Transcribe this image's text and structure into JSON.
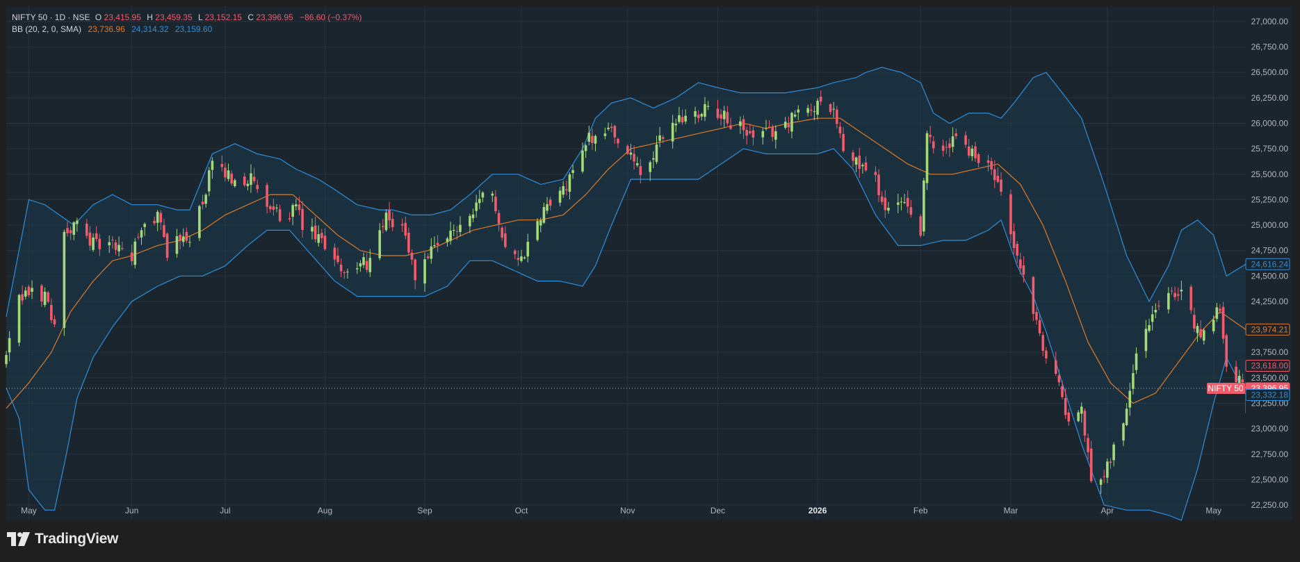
{
  "header": {
    "symbol": "NIFTY 50 · 1D · NSE",
    "o_label": "O",
    "o_value": "23,415.95",
    "h_label": "H",
    "h_value": "23,459.35",
    "l_label": "L",
    "l_value": "23,152.15",
    "c_label": "C",
    "c_value": "23,396.95",
    "change": "−86.60 (−0.37%)",
    "bb_label": "BB (20, 2, 0, SMA)",
    "bb_basis": "23,736.96",
    "bb_upper": "24,314.32",
    "bb_lower": "23,159.60"
  },
  "branding": {
    "name": "TradingView"
  },
  "colors": {
    "up": "#a3d977",
    "down": "#f15b6c",
    "upper_band": "#2f8fdc",
    "lower_band": "#2f8fdc",
    "basis": "#e07a26",
    "band_fill": "#1c3a4c",
    "background": "#1a252e",
    "grid": "#263540",
    "text": "#b2b5be"
  },
  "chart_data": {
    "type": "candlestick",
    "symbol": "NIFTY 50",
    "interval": "1D",
    "exchange": "NSE",
    "indicator": "Bollinger Bands (20, 2, 0, SMA)",
    "y_range": [
      22100,
      27150
    ],
    "y_ticks": [
      "27,000.00",
      "26,750.00",
      "26,500.00",
      "26,250.00",
      "26,000.00",
      "25,750.00",
      "25,500.00",
      "25,250.00",
      "25,000.00",
      "24,750.00",
      "24,500.00",
      "24,250.00",
      "24,000.00",
      "23,750.00",
      "23,500.00",
      "23,250.00",
      "23,000.00",
      "22,750.00",
      "22,500.00",
      "22,250.00"
    ],
    "x_range": [
      "2025-04-24",
      "2026-05-14"
    ],
    "x_ticks": [
      {
        "label": "May",
        "date": "2025-05-01"
      },
      {
        "label": "Jun",
        "date": "2025-06-02"
      },
      {
        "label": "Jul",
        "date": "2025-07-01"
      },
      {
        "label": "Aug",
        "date": "2025-08-01"
      },
      {
        "label": "Sep",
        "date": "2025-09-01"
      },
      {
        "label": "Oct",
        "date": "2025-10-01"
      },
      {
        "label": "Nov",
        "date": "2025-11-03"
      },
      {
        "label": "Dec",
        "date": "2025-12-01"
      },
      {
        "label": "2026",
        "date": "2026-01-01"
      },
      {
        "label": "Feb",
        "date": "2026-02-02"
      },
      {
        "label": "Mar",
        "date": "2026-03-02"
      },
      {
        "label": "Apr",
        "date": "2026-04-01"
      },
      {
        "label": "May",
        "date": "2026-05-04"
      }
    ],
    "close_points": [
      [
        "2025-04-24",
        23700
      ],
      [
        "2025-04-28",
        24250
      ],
      [
        "2025-05-02",
        24350
      ],
      [
        "2025-05-06",
        24300
      ],
      [
        "2025-05-09",
        24050
      ],
      [
        "2025-05-12",
        24900
      ],
      [
        "2025-05-16",
        25000
      ],
      [
        "2025-05-22",
        24800
      ],
      [
        "2025-05-27",
        24800
      ],
      [
        "2025-06-02",
        24700
      ],
      [
        "2025-06-06",
        25000
      ],
      [
        "2025-06-10",
        25100
      ],
      [
        "2025-06-13",
        24750
      ],
      [
        "2025-06-17",
        24850
      ],
      [
        "2025-06-20",
        24900
      ],
      [
        "2025-06-24",
        25200
      ],
      [
        "2025-06-27",
        25600
      ],
      [
        "2025-07-01",
        25500
      ],
      [
        "2025-07-04",
        25450
      ],
      [
        "2025-07-09",
        25450
      ],
      [
        "2025-07-14",
        25150
      ],
      [
        "2025-07-18",
        25100
      ],
      [
        "2025-07-23",
        25150
      ],
      [
        "2025-07-25",
        25000
      ],
      [
        "2025-07-30",
        24850
      ],
      [
        "2025-08-04",
        24700
      ],
      [
        "2025-08-08",
        24500
      ],
      [
        "2025-08-12",
        24600
      ],
      [
        "2025-08-15",
        24650
      ],
      [
        "2025-08-20",
        25050
      ],
      [
        "2025-08-25",
        25000
      ],
      [
        "2025-08-29",
        24500
      ],
      [
        "2025-09-02",
        24700
      ],
      [
        "2025-09-05",
        24750
      ],
      [
        "2025-09-10",
        24950
      ],
      [
        "2025-09-15",
        25100
      ],
      [
        "2025-09-19",
        25350
      ],
      [
        "2025-09-23",
        25200
      ],
      [
        "2025-09-26",
        24800
      ],
      [
        "2025-10-01",
        24650
      ],
      [
        "2025-10-06",
        25000
      ],
      [
        "2025-10-10",
        25250
      ],
      [
        "2025-10-15",
        25350
      ],
      [
        "2025-10-20",
        25800
      ],
      [
        "2025-10-24",
        25900
      ],
      [
        "2025-10-29",
        25950
      ],
      [
        "2025-11-03",
        25700
      ],
      [
        "2025-11-07",
        25500
      ],
      [
        "2025-11-11",
        25650
      ],
      [
        "2025-11-14",
        25900
      ],
      [
        "2025-11-19",
        26050
      ],
      [
        "2025-11-24",
        26100
      ],
      [
        "2025-11-28",
        26200
      ],
      [
        "2025-12-03",
        26050
      ],
      [
        "2025-12-08",
        25950
      ],
      [
        "2025-12-12",
        25850
      ],
      [
        "2025-12-17",
        25900
      ],
      [
        "2025-12-22",
        26000
      ],
      [
        "2025-12-26",
        26100
      ],
      [
        "2025-12-31",
        26150
      ],
      [
        "2026-01-02",
        26250
      ],
      [
        "2026-01-06",
        26150
      ],
      [
        "2026-01-09",
        25700
      ],
      [
        "2026-01-14",
        25600
      ],
      [
        "2026-01-19",
        25450
      ],
      [
        "2026-01-22",
        25150
      ],
      [
        "2026-01-27",
        25200
      ],
      [
        "2026-02-02",
        24950
      ],
      [
        "2026-02-04",
        25850
      ],
      [
        "2026-02-09",
        25700
      ],
      [
        "2026-02-13",
        25900
      ],
      [
        "2026-02-18",
        25700
      ],
      [
        "2026-02-23",
        25600
      ],
      [
        "2026-02-27",
        25300
      ],
      [
        "2026-03-02",
        24850
      ],
      [
        "2026-03-06",
        24500
      ],
      [
        "2026-03-10",
        24000
      ],
      [
        "2026-03-13",
        23700
      ],
      [
        "2026-03-17",
        23500
      ],
      [
        "2026-03-20",
        23000
      ],
      [
        "2026-03-24",
        23200
      ],
      [
        "2026-03-27",
        22500
      ],
      [
        "2026-03-31",
        22600
      ],
      [
        "2026-04-03",
        22800
      ],
      [
        "2026-04-07",
        23200
      ],
      [
        "2026-04-10",
        23800
      ],
      [
        "2026-04-15",
        24100
      ],
      [
        "2026-04-20",
        24400
      ],
      [
        "2026-04-24",
        24300
      ],
      [
        "2026-04-29",
        23950
      ],
      [
        "2026-05-04",
        24050
      ],
      [
        "2026-05-06",
        24200
      ],
      [
        "2026-05-08",
        23600
      ],
      [
        "2026-05-12",
        23500
      ],
      [
        "2026-05-14",
        23396.95
      ]
    ],
    "last_close": 23396.95,
    "bb_upper_points": [
      [
        "2025-04-24",
        24100
      ],
      [
        "2025-05-01",
        25250
      ],
      [
        "2025-05-06",
        25200
      ],
      [
        "2025-05-15",
        25000
      ],
      [
        "2025-05-21",
        25200
      ],
      [
        "2025-05-27",
        25300
      ],
      [
        "2025-06-02",
        25200
      ],
      [
        "2025-06-10",
        25200
      ],
      [
        "2025-06-16",
        25150
      ],
      [
        "2025-06-20",
        25150
      ],
      [
        "2025-06-27",
        25700
      ],
      [
        "2025-07-04",
        25800
      ],
      [
        "2025-07-11",
        25700
      ],
      [
        "2025-07-18",
        25650
      ],
      [
        "2025-07-23",
        25550
      ],
      [
        "2025-07-30",
        25450
      ],
      [
        "2025-08-04",
        25350
      ],
      [
        "2025-08-11",
        25200
      ],
      [
        "2025-08-18",
        25150
      ],
      [
        "2025-08-22",
        25150
      ],
      [
        "2025-08-28",
        25100
      ],
      [
        "2025-09-03",
        25100
      ],
      [
        "2025-09-09",
        25150
      ],
      [
        "2025-09-15",
        25300
      ],
      [
        "2025-09-22",
        25500
      ],
      [
        "2025-09-30",
        25500
      ],
      [
        "2025-10-07",
        25400
      ],
      [
        "2025-10-14",
        25450
      ],
      [
        "2025-10-20",
        25750
      ],
      [
        "2025-10-24",
        26050
      ],
      [
        "2025-10-29",
        26200
      ],
      [
        "2025-11-04",
        26250
      ],
      [
        "2025-11-11",
        26150
      ],
      [
        "2025-11-18",
        26250
      ],
      [
        "2025-11-25",
        26400
      ],
      [
        "2025-12-01",
        26350
      ],
      [
        "2025-12-08",
        26300
      ],
      [
        "2025-12-15",
        26300
      ],
      [
        "2025-12-22",
        26300
      ],
      [
        "2026-01-01",
        26350
      ],
      [
        "2026-01-06",
        26400
      ],
      [
        "2026-01-13",
        26450
      ],
      [
        "2026-01-16",
        26500
      ],
      [
        "2026-01-21",
        26550
      ],
      [
        "2026-01-27",
        26500
      ],
      [
        "2026-02-02",
        26400
      ],
      [
        "2026-02-06",
        26100
      ],
      [
        "2026-02-11",
        26000
      ],
      [
        "2026-02-17",
        26100
      ],
      [
        "2026-02-23",
        26100
      ],
      [
        "2026-02-27",
        26050
      ],
      [
        "2026-03-03",
        26200
      ],
      [
        "2026-03-09",
        26450
      ],
      [
        "2026-03-13",
        26500
      ],
      [
        "2026-03-18",
        26300
      ],
      [
        "2026-03-24",
        26050
      ],
      [
        "2026-03-31",
        25400
      ],
      [
        "2026-04-07",
        24700
      ],
      [
        "2026-04-14",
        24250
      ],
      [
        "2026-04-20",
        24600
      ],
      [
        "2026-04-24",
        24950
      ],
      [
        "2026-04-29",
        25050
      ],
      [
        "2026-05-04",
        24900
      ],
      [
        "2026-05-08",
        24500
      ],
      [
        "2026-05-14",
        24616.24
      ]
    ],
    "bb_basis_points": [
      [
        "2025-04-24",
        23200
      ],
      [
        "2025-05-01",
        23450
      ],
      [
        "2025-05-08",
        23750
      ],
      [
        "2025-05-14",
        24150
      ],
      [
        "2025-05-21",
        24450
      ],
      [
        "2025-05-27",
        24650
      ],
      [
        "2025-06-02",
        24700
      ],
      [
        "2025-06-10",
        24800
      ],
      [
        "2025-06-17",
        24850
      ],
      [
        "2025-06-24",
        24950
      ],
      [
        "2025-07-01",
        25100
      ],
      [
        "2025-07-08",
        25200
      ],
      [
        "2025-07-15",
        25300
      ],
      [
        "2025-07-22",
        25300
      ],
      [
        "2025-07-29",
        25100
      ],
      [
        "2025-08-05",
        24900
      ],
      [
        "2025-08-12",
        24750
      ],
      [
        "2025-08-19",
        24700
      ],
      [
        "2025-08-26",
        24700
      ],
      [
        "2025-09-02",
        24750
      ],
      [
        "2025-09-09",
        24850
      ],
      [
        "2025-09-16",
        24950
      ],
      [
        "2025-09-23",
        25000
      ],
      [
        "2025-09-30",
        25050
      ],
      [
        "2025-10-07",
        25050
      ],
      [
        "2025-10-14",
        25100
      ],
      [
        "2025-10-21",
        25300
      ],
      [
        "2025-10-28",
        25550
      ],
      [
        "2025-11-04",
        25750
      ],
      [
        "2025-11-11",
        25800
      ],
      [
        "2025-11-18",
        25850
      ],
      [
        "2025-11-25",
        25900
      ],
      [
        "2025-12-02",
        25950
      ],
      [
        "2025-12-09",
        26000
      ],
      [
        "2025-12-16",
        25950
      ],
      [
        "2025-12-23",
        26000
      ],
      [
        "2026-01-01",
        26050
      ],
      [
        "2026-01-08",
        26050
      ],
      [
        "2026-01-15",
        25900
      ],
      [
        "2026-01-22",
        25750
      ],
      [
        "2026-01-29",
        25600
      ],
      [
        "2026-02-05",
        25500
      ],
      [
        "2026-02-12",
        25500
      ],
      [
        "2026-02-19",
        25550
      ],
      [
        "2026-02-26",
        25600
      ],
      [
        "2026-03-05",
        25400
      ],
      [
        "2026-03-12",
        25000
      ],
      [
        "2026-03-19",
        24450
      ],
      [
        "2026-03-26",
        23850
      ],
      [
        "2026-04-02",
        23450
      ],
      [
        "2026-04-09",
        23250
      ],
      [
        "2026-04-16",
        23350
      ],
      [
        "2026-04-23",
        23650
      ],
      [
        "2026-04-30",
        23950
      ],
      [
        "2026-05-06",
        24150
      ],
      [
        "2026-05-14",
        23974.21
      ]
    ],
    "bb_lower_points": [
      [
        "2025-04-24",
        23400
      ],
      [
        "2025-04-28",
        23100
      ],
      [
        "2025-05-01",
        22400
      ],
      [
        "2025-05-06",
        22200
      ],
      [
        "2025-05-09",
        22200
      ],
      [
        "2025-05-13",
        22800
      ],
      [
        "2025-05-16",
        23300
      ],
      [
        "2025-05-21",
        23700
      ],
      [
        "2025-05-27",
        24000
      ],
      [
        "2025-06-02",
        24250
      ],
      [
        "2025-06-10",
        24400
      ],
      [
        "2025-06-17",
        24500
      ],
      [
        "2025-06-24",
        24500
      ],
      [
        "2025-07-01",
        24600
      ],
      [
        "2025-07-08",
        24800
      ],
      [
        "2025-07-14",
        24950
      ],
      [
        "2025-07-21",
        24950
      ],
      [
        "2025-07-28",
        24700
      ],
      [
        "2025-08-04",
        24450
      ],
      [
        "2025-08-11",
        24300
      ],
      [
        "2025-08-18",
        24300
      ],
      [
        "2025-08-25",
        24300
      ],
      [
        "2025-09-01",
        24300
      ],
      [
        "2025-09-08",
        24400
      ],
      [
        "2025-09-15",
        24650
      ],
      [
        "2025-09-22",
        24650
      ],
      [
        "2025-09-29",
        24550
      ],
      [
        "2025-10-06",
        24450
      ],
      [
        "2025-10-13",
        24450
      ],
      [
        "2025-10-20",
        24400
      ],
      [
        "2025-10-24",
        24600
      ],
      [
        "2025-10-29",
        25000
      ],
      [
        "2025-11-04",
        25450
      ],
      [
        "2025-11-11",
        25450
      ],
      [
        "2025-11-18",
        25450
      ],
      [
        "2025-11-25",
        25450
      ],
      [
        "2025-12-02",
        25600
      ],
      [
        "2025-12-09",
        25750
      ],
      [
        "2025-12-16",
        25700
      ],
      [
        "2025-12-23",
        25700
      ],
      [
        "2026-01-01",
        25700
      ],
      [
        "2026-01-06",
        25750
      ],
      [
        "2026-01-12",
        25550
      ],
      [
        "2026-01-19",
        25100
      ],
      [
        "2026-01-26",
        24800
      ],
      [
        "2026-02-02",
        24800
      ],
      [
        "2026-02-09",
        24850
      ],
      [
        "2026-02-16",
        24850
      ],
      [
        "2026-02-23",
        24950
      ],
      [
        "2026-02-27",
        25050
      ],
      [
        "2026-03-04",
        24600
      ],
      [
        "2026-03-09",
        24300
      ],
      [
        "2026-03-13",
        23950
      ],
      [
        "2026-03-18",
        23450
      ],
      [
        "2026-03-24",
        22850
      ],
      [
        "2026-03-31",
        22250
      ],
      [
        "2026-04-07",
        22200
      ],
      [
        "2026-04-14",
        22200
      ],
      [
        "2026-04-20",
        22150
      ],
      [
        "2026-04-24",
        22100
      ],
      [
        "2026-04-29",
        22600
      ],
      [
        "2026-05-04",
        23250
      ],
      [
        "2026-05-08",
        23700
      ],
      [
        "2026-05-14",
        23332.18
      ]
    ],
    "price_labels": [
      {
        "name": "bb-upper",
        "value": "24,616.24"
      },
      {
        "name": "bb-basis",
        "value": "23,974.21"
      },
      {
        "name": "high-marker",
        "value": "23,618.00"
      },
      {
        "name": "last",
        "value": "23,396.95",
        "tag": "NIFTY 50"
      },
      {
        "name": "bb-lower",
        "value": "23,332.18"
      }
    ]
  }
}
